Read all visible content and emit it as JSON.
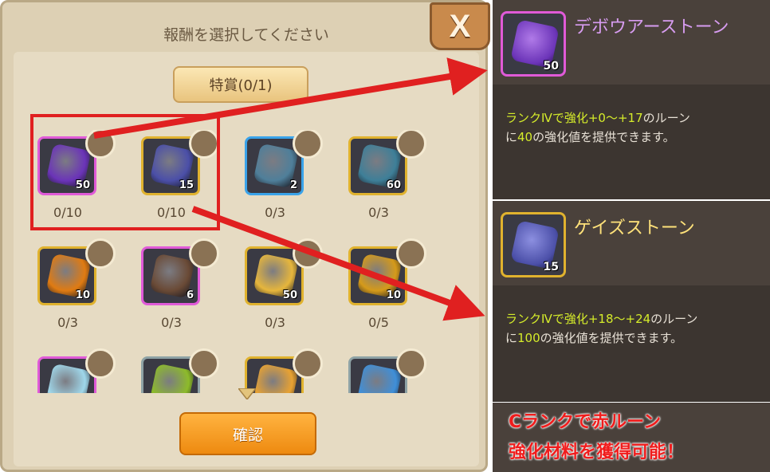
{
  "dialog": {
    "title": "報酬を選択してください",
    "close_label": "X",
    "prize_tab": "特賞(0/1)",
    "confirm_label": "確認"
  },
  "items": [
    {
      "qty": "50",
      "count": "0/10",
      "color": "#6b34b8",
      "frame": "purple"
    },
    {
      "qty": "15",
      "count": "0/10",
      "color": "#4b4fa8",
      "frame": "gold"
    },
    {
      "qty": "2",
      "count": "0/3",
      "color": "#4f7f9a",
      "frame": "blue"
    },
    {
      "qty": "60",
      "count": "0/3",
      "color": "#3e7f98",
      "frame": "gold"
    },
    {
      "qty": "10",
      "count": "0/3",
      "color": "#e07b12",
      "frame": "gold"
    },
    {
      "qty": "6",
      "count": "0/3",
      "color": "#6a4a36",
      "frame": "purple"
    },
    {
      "qty": "50",
      "count": "0/3",
      "color": "#e6b63c",
      "frame": "gold"
    },
    {
      "qty": "10",
      "count": "0/5",
      "color": "#d59a1a",
      "frame": "gold"
    },
    {
      "qty": "",
      "count": "",
      "color": "#9fd7ea",
      "frame": "purple"
    },
    {
      "qty": "",
      "count": "",
      "color": "#8dbb2a",
      "frame": "gray"
    },
    {
      "qty": "",
      "count": "",
      "color": "#e8a232",
      "frame": "gold"
    },
    {
      "qty": "",
      "count": "",
      "color": "#3f8fd8",
      "frame": "gray"
    }
  ],
  "tooltips": [
    {
      "name": "デボウアーストーン",
      "qty": "50",
      "color": "#6b34b8",
      "border": "#e05ad8",
      "desc_pre": "ランクⅣで強化+0〜+17",
      "desc_mid": "のルーン\nに",
      "desc_num": "40",
      "desc_post": "の強化値を提供できます。"
    },
    {
      "name": "ゲイズストーン",
      "qty": "15",
      "color": "#4b4fa8",
      "border": "#e0b22e",
      "desc_pre": "ランクⅣで強化+18〜+24",
      "desc_mid": "のルーン\nに",
      "desc_num": "100",
      "desc_post": "の強化値を提供できます。"
    }
  ],
  "caption": {
    "line1": "Cランクで赤ルーン",
    "line2": "強化材料を獲得可能！"
  },
  "colors": {
    "annotation_red": "#e02020"
  }
}
